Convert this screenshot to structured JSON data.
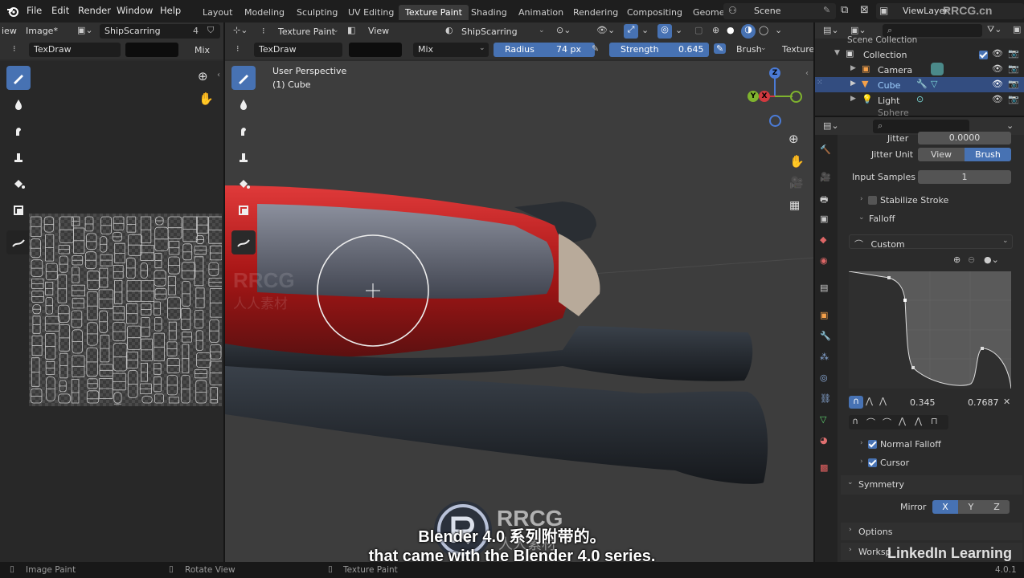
{
  "menus": [
    "File",
    "Edit",
    "Render",
    "Window",
    "Help"
  ],
  "workspaces": [
    "Layout",
    "Modeling",
    "Sculpting",
    "UV Editing",
    "Texture Paint",
    "Shading",
    "Animation",
    "Rendering",
    "Compositing",
    "Geome"
  ],
  "active_workspace_index": 4,
  "scene": "Scene",
  "view_layer": "ViewLayer",
  "watermark_top": "RRCG.cn",
  "image_editor": {
    "header": {
      "view": "iew",
      "image": "Image*",
      "image_name": "ShipScarring",
      "users": "4"
    },
    "tool_header": {
      "brush": "TexDraw",
      "blend": "Mix"
    }
  },
  "viewport": {
    "header": {
      "mode": "Texture Paint",
      "view": "View",
      "image": "ShipScarring"
    },
    "tool_header": {
      "brush": "TexDraw",
      "blend": "Mix",
      "radius_label": "Radius",
      "radius_value": "74 px",
      "strength_label": "Strength",
      "strength_value": "0.645",
      "brush_menu": "Brush",
      "texture_menu": "Texture"
    },
    "overlay_title": "User Perspective",
    "overlay_object": "(1) Cube",
    "watermark": "RRCG",
    "watermark_cn": "人人素材",
    "gizmo": {
      "z": "Z",
      "y": "Y",
      "x": "X"
    }
  },
  "outliner": {
    "title": "Scene Collection",
    "items": [
      {
        "label": "Collection",
        "indent": 0
      },
      {
        "label": "Camera",
        "indent": 1
      },
      {
        "label": "Cube",
        "indent": 1,
        "selected": true
      },
      {
        "label": "Light",
        "indent": 1
      },
      {
        "label": "Sphere",
        "indent": 1
      }
    ]
  },
  "properties": {
    "jitter_label": "Jitter",
    "jitter_value": "0.0000",
    "jitter_unit_label": "Jitter Unit",
    "jitter_unit_options": [
      "View",
      "Brush"
    ],
    "jitter_unit_selected": "Brush",
    "input_samples_label": "Input Samples",
    "input_samples_value": "1",
    "stabilize_stroke": "Stabilize Stroke",
    "falloff": "Falloff",
    "falloff_preset": "Custom",
    "curve_x": "0.345",
    "curve_y": "0.7687",
    "normal_falloff": "Normal Falloff",
    "cursor": "Cursor",
    "symmetry": "Symmetry",
    "mirror_label": "Mirror",
    "mirror_axes": [
      "X",
      "Y",
      "Z"
    ],
    "options": "Options",
    "workspace": "Worksp"
  },
  "subtitles": {
    "line1": "Blender 4.0 系列附带的。",
    "line2": "that came with the Blender 4.0 series."
  },
  "logo_text": "RRCG",
  "logo_cn": "人人素材",
  "linkedin": "LinkedIn Learning",
  "status": {
    "left": "Image Paint",
    "mid": "Rotate View",
    "right": "Texture Paint",
    "version": "4.0.1"
  },
  "colors": {
    "accent": "#4772b3",
    "body_red": "#b01c1c"
  }
}
